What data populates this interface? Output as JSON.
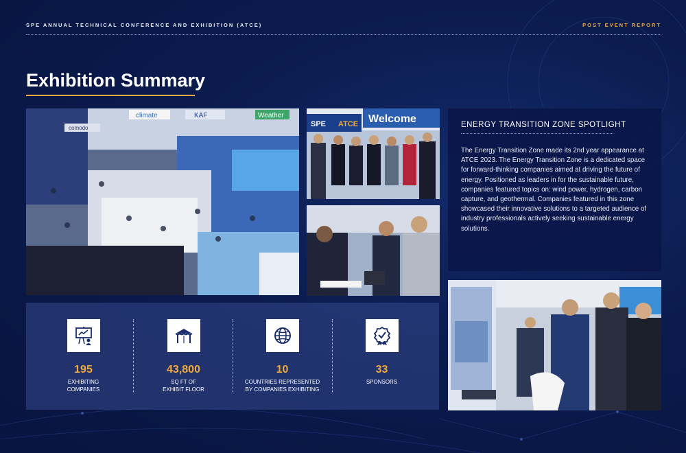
{
  "header": {
    "event_title": "SPE ANNUAL TECHNICAL CONFERENCE AND EXHIBITION (ATCE)",
    "report_type": "POST EVENT REPORT"
  },
  "page": {
    "title": "Exhibition Summary"
  },
  "photos": {
    "hall_signs": [
      "climate",
      "KAF",
      "Weather",
      "comodo"
    ],
    "booth_signs": [
      "SPE",
      "ATCE",
      "Welcome"
    ]
  },
  "stats": [
    {
      "icon": "presentation-icon",
      "value": "195",
      "label_line1": "EXHIBITING",
      "label_line2": "COMPANIES"
    },
    {
      "icon": "booth-tent-icon",
      "value": "43,800",
      "label_line1": "SQ FT OF",
      "label_line2": "EXHIBIT FLOOR"
    },
    {
      "icon": "globe-icon",
      "value": "10",
      "label_line1": "COUNTRIES REPRESENTED",
      "label_line2": "BY COMPANIES EXHIBITING"
    },
    {
      "icon": "award-badge-icon",
      "value": "33",
      "label_line1": "SPONSORS",
      "label_line2": ""
    }
  ],
  "spotlight": {
    "title": "ENERGY TRANSITION ZONE SPOTLIGHT",
    "body": "The Energy Transition Zone made its 2nd year appearance at ATCE 2023. The Energy Transition Zone is a dedicated space for forward-thinking companies aimed at driving the future of energy. Positioned as leaders in for the sustainable future, companies featured topics on: wind power, hydrogen, carbon capture, and geothermal. Companies featured in this zone showcased their innovative solutions to a targeted audience of industry professionals actively seeking sustainable energy solutions."
  },
  "colors": {
    "background": "#0b1b4d",
    "accent": "#f2a93b",
    "panel": "#34488c",
    "spotlight_panel": "#0a1648"
  }
}
